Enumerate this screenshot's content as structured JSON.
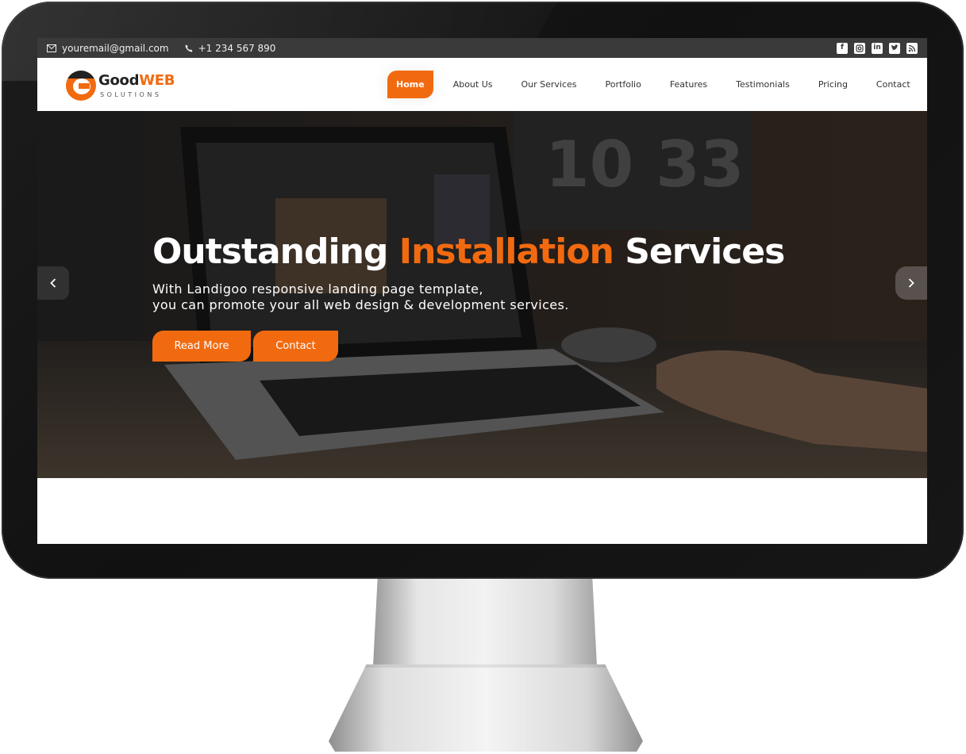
{
  "topbar": {
    "email": "youremail@gmail.com",
    "phone": "+1 234 567 890",
    "social": [
      "facebook-icon",
      "instagram-icon",
      "linkedin-icon",
      "twitter-icon",
      "rss-icon"
    ]
  },
  "brand": {
    "name_part1": "Good",
    "name_part2": "WEB",
    "tagline": "SOLUTIONS"
  },
  "nav": {
    "items": [
      {
        "label": "Home",
        "active": true
      },
      {
        "label": "About Us"
      },
      {
        "label": "Our Services"
      },
      {
        "label": "Portfolio"
      },
      {
        "label": "Features"
      },
      {
        "label": "Testimonials"
      },
      {
        "label": "Pricing"
      },
      {
        "label": "Contact"
      }
    ]
  },
  "hero": {
    "title_part1": "Outstanding",
    "title_accent": "Installation",
    "title_part2": "Services",
    "subtitle_line1": "With Landigoo responsive landing page template,",
    "subtitle_line2": "you can promote your all web design & development services.",
    "btn_primary": "Read More",
    "btn_secondary": "Contact",
    "clock_text": "10 33"
  },
  "colors": {
    "accent": "#f26a10",
    "topbar": "#3a3a3a"
  }
}
